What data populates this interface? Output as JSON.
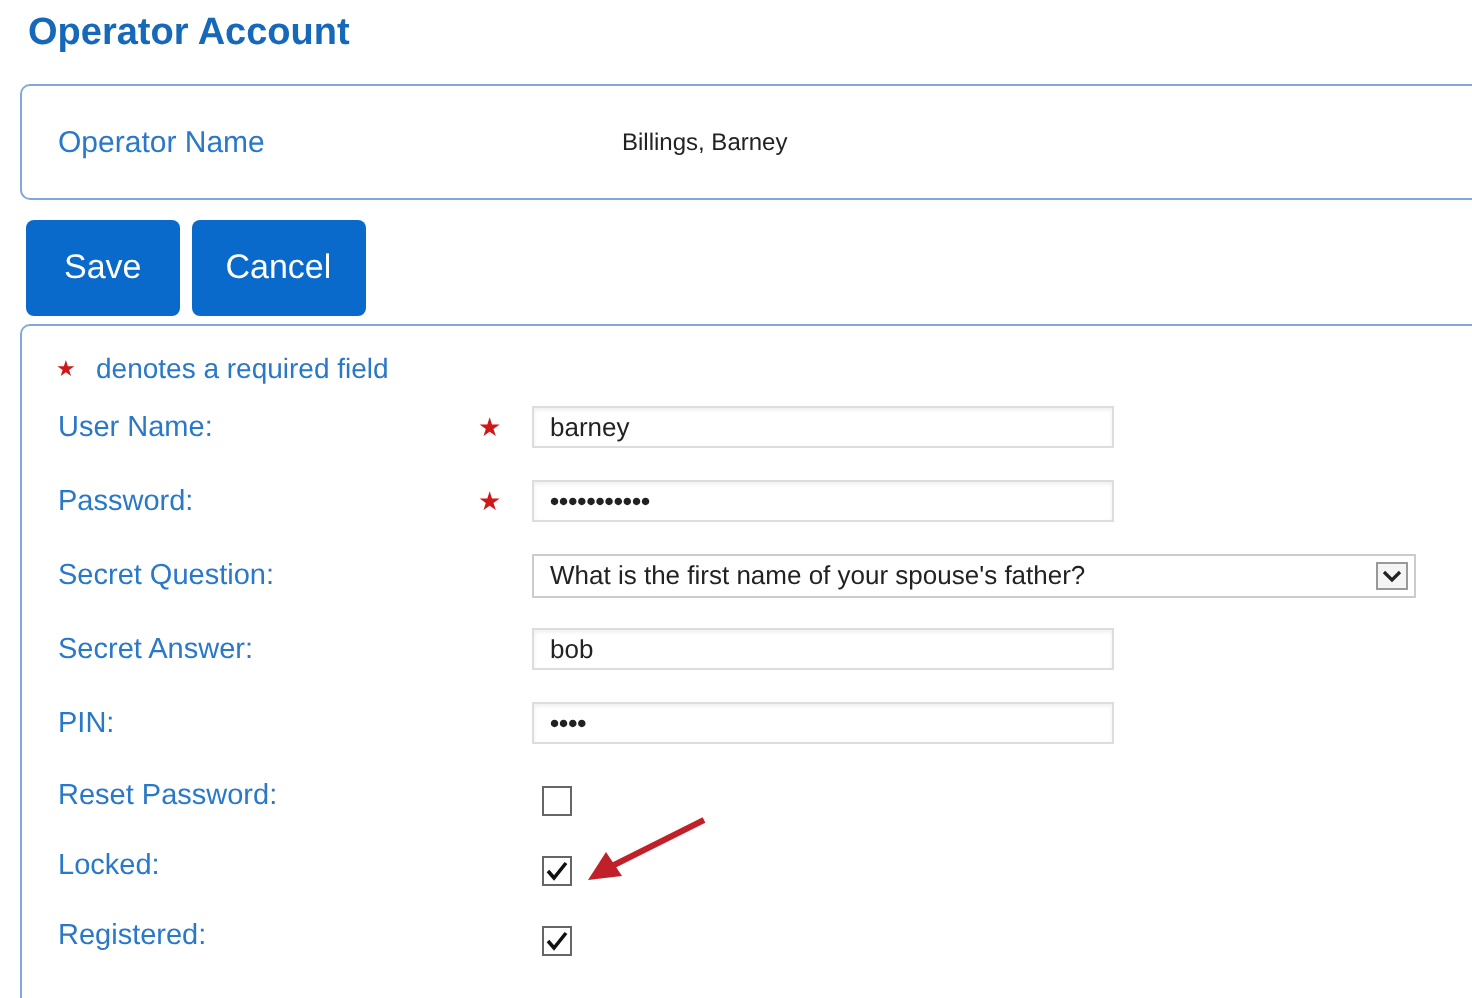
{
  "title": "Operator Account",
  "operator": {
    "label": "Operator Name",
    "value": "Billings, Barney"
  },
  "buttons": [
    {
      "label": "Save"
    },
    {
      "label": "Cancel"
    }
  ],
  "required_note": {
    "marker": "★",
    "text": "denotes a required field"
  },
  "fields": [
    {
      "label": "User Name:",
      "required": true,
      "kind": "text",
      "value": "barney"
    },
    {
      "label": "Password:",
      "required": true,
      "kind": "password",
      "value": "•••••••••••"
    },
    {
      "label": "Secret Question:",
      "required": false,
      "kind": "select",
      "value": "What is the first name of your spouse's father?"
    },
    {
      "label": "Secret Answer:",
      "required": false,
      "kind": "text",
      "value": "bob"
    },
    {
      "label": "PIN:",
      "required": false,
      "kind": "password",
      "value": "••••"
    },
    {
      "label": "Reset Password:",
      "required": false,
      "kind": "checkbox",
      "checked": false,
      "highlighted": false
    },
    {
      "label": "Locked:",
      "required": false,
      "kind": "checkbox",
      "checked": true,
      "highlighted": true
    },
    {
      "label": "Registered:",
      "required": false,
      "kind": "checkbox",
      "checked": true,
      "highlighted": false
    }
  ]
}
